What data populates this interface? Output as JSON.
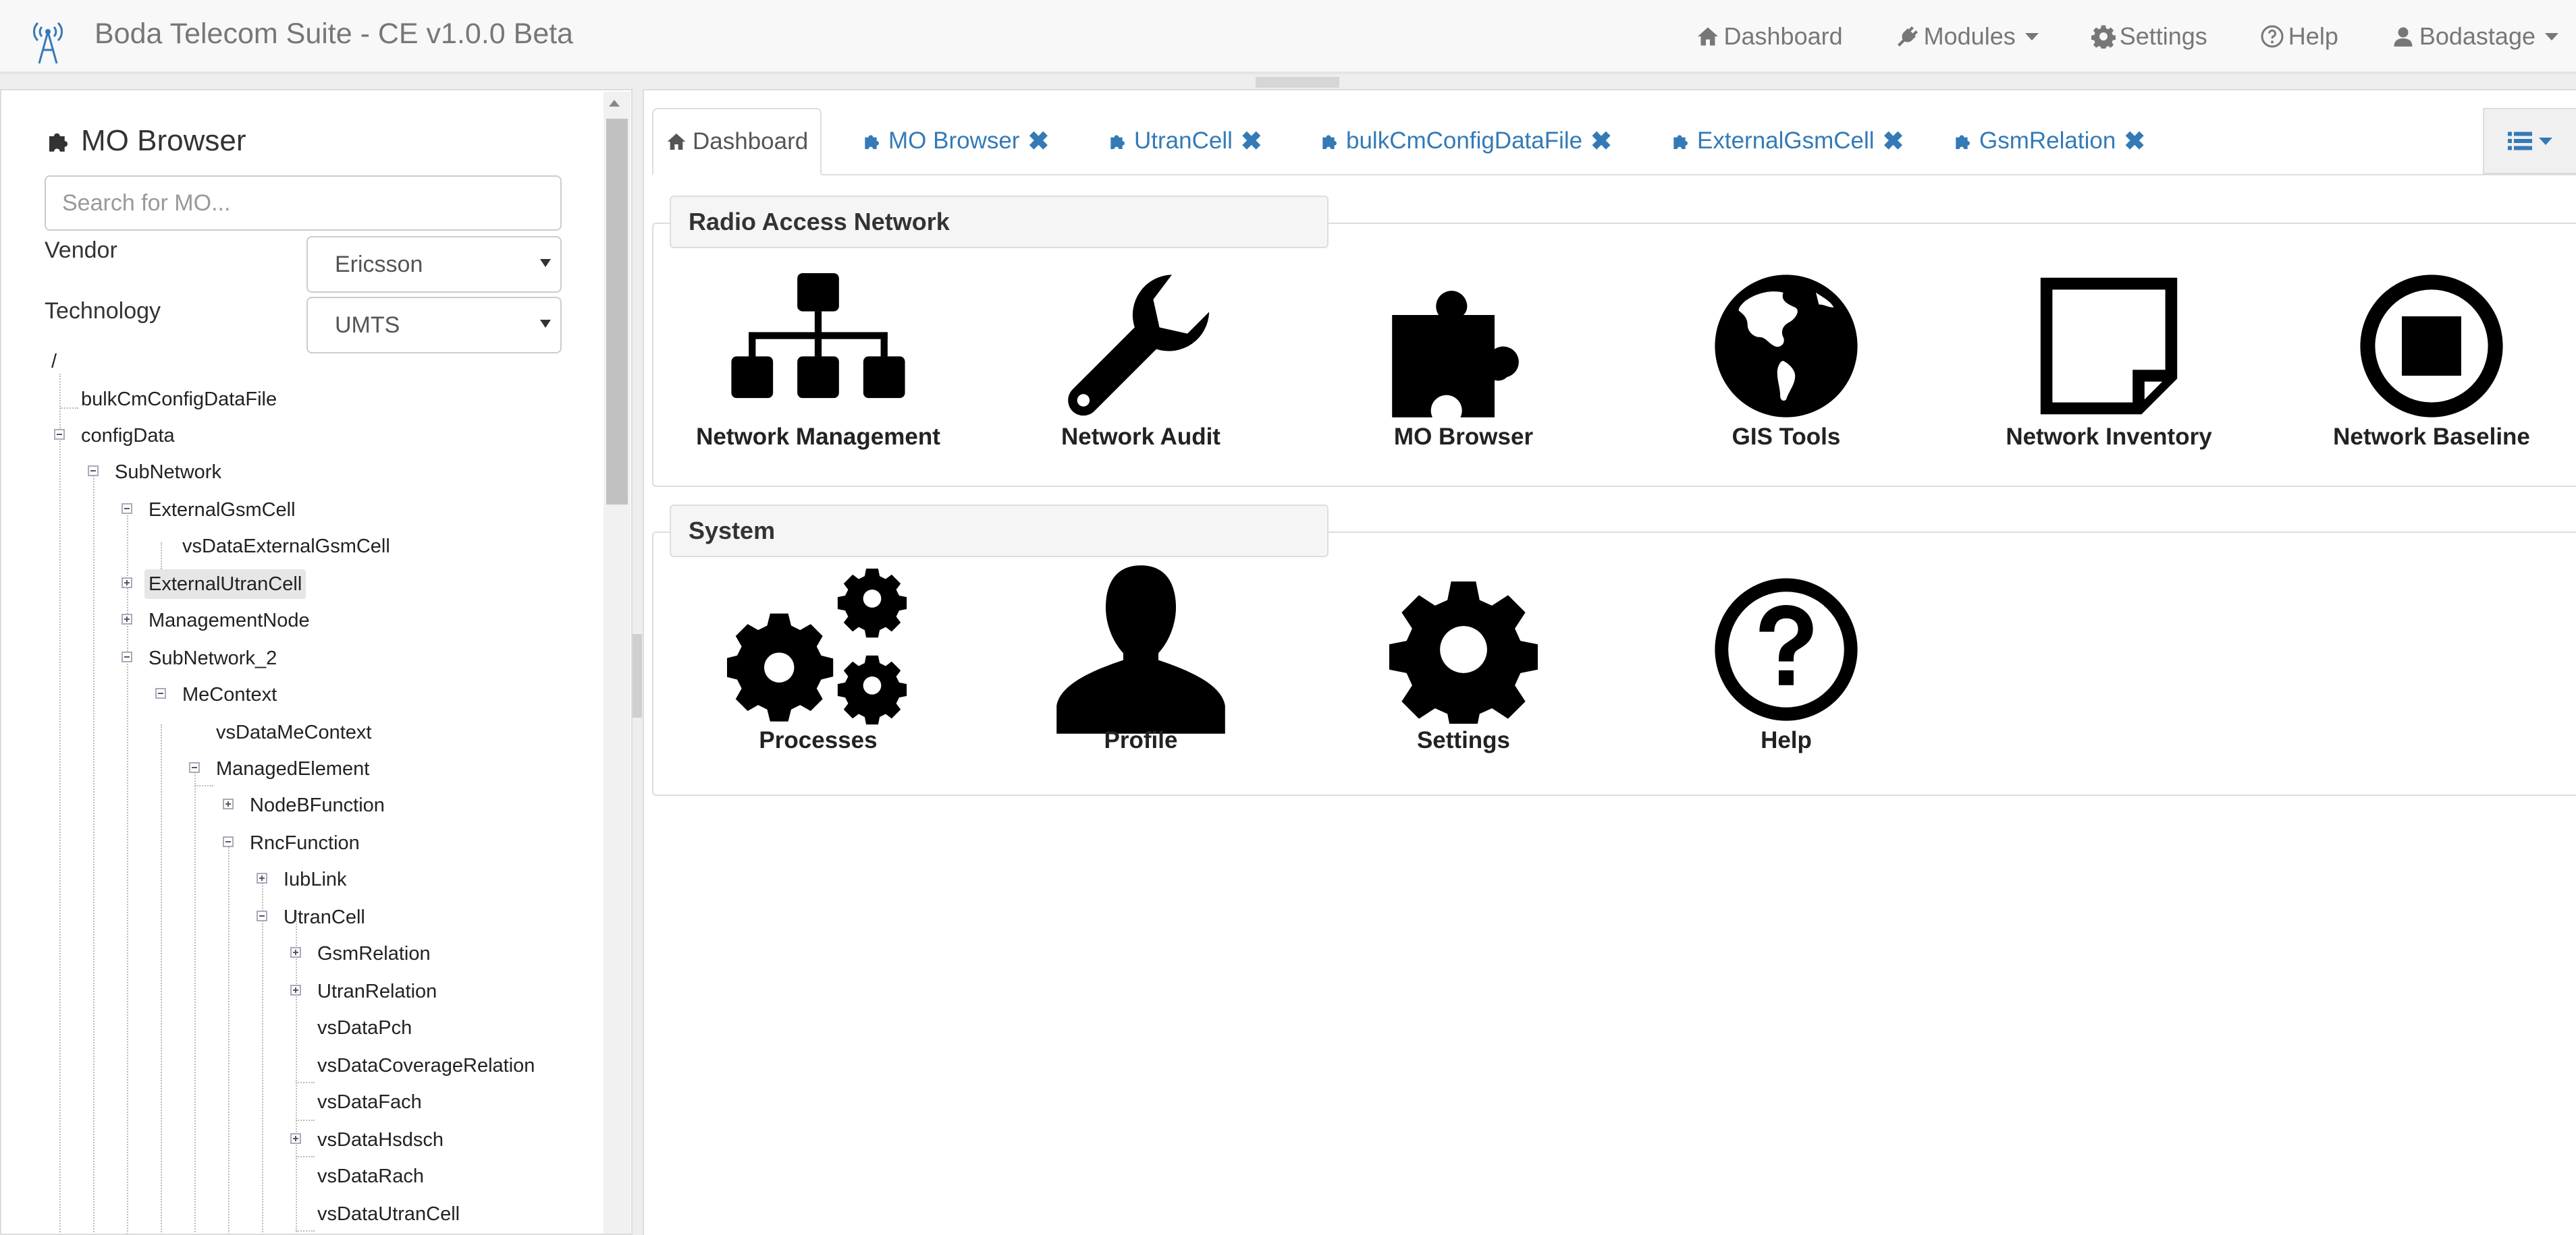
{
  "navbar": {
    "brand": "Boda Telecom Suite - CE v1.0.0 Beta",
    "items": [
      {
        "label": "Dashboard",
        "icon": "home-icon"
      },
      {
        "label": "Modules",
        "icon": "plug-icon"
      },
      {
        "label": "Settings",
        "icon": "gear-icon"
      },
      {
        "label": "Help",
        "icon": "question-circle-icon"
      },
      {
        "label": "Bodastage",
        "icon": "user-icon"
      }
    ]
  },
  "sidebar": {
    "title": "MO Browser",
    "search_placeholder": "Search for MO...",
    "vendor_label": "Vendor",
    "vendor_value": "Ericsson",
    "technology_label": "Technology",
    "technology_value": "UMTS",
    "tree": [
      {
        "label": "/"
      },
      {
        "label": "bulkCmConfigDataFile"
      },
      {
        "label": "configData",
        "toggle": "minus"
      },
      {
        "label": "SubNetwork",
        "toggle": "minus"
      },
      {
        "label": "ExternalGsmCell",
        "toggle": "minus"
      },
      {
        "label": "vsDataExternalGsmCell"
      },
      {
        "label": "ExternalUtranCell",
        "toggle": "plus",
        "selected": true
      },
      {
        "label": "ManagementNode",
        "toggle": "plus"
      },
      {
        "label": "SubNetwork_2",
        "toggle": "minus"
      },
      {
        "label": "MeContext",
        "toggle": "minus"
      },
      {
        "label": "vsDataMeContext"
      },
      {
        "label": "ManagedElement",
        "toggle": "minus"
      },
      {
        "label": "NodeBFunction",
        "toggle": "plus"
      },
      {
        "label": "RncFunction",
        "toggle": "minus"
      },
      {
        "label": "IubLink",
        "toggle": "plus"
      },
      {
        "label": "UtranCell",
        "toggle": "minus"
      },
      {
        "label": "GsmRelation",
        "toggle": "plus"
      },
      {
        "label": "UtranRelation",
        "toggle": "plus"
      },
      {
        "label": "vsDataPch"
      },
      {
        "label": "vsDataCoverageRelation"
      },
      {
        "label": "vsDataFach"
      },
      {
        "label": "vsDataHsdsch",
        "toggle": "plus"
      },
      {
        "label": "vsDataRach"
      },
      {
        "label": "vsDataUtranCell"
      }
    ]
  },
  "tabs": [
    {
      "label": "Dashboard",
      "icon": "home-icon",
      "closable": false,
      "active": true
    },
    {
      "label": "MO Browser",
      "icon": "puzzle-icon",
      "closable": true
    },
    {
      "label": "UtranCell",
      "icon": "puzzle-icon",
      "closable": true
    },
    {
      "label": "bulkCmConfigDataFile",
      "icon": "puzzle-icon",
      "closable": true
    },
    {
      "label": "ExternalGsmCell",
      "icon": "puzzle-icon",
      "closable": true
    },
    {
      "label": "GsmRelation",
      "icon": "puzzle-icon",
      "closable": true
    }
  ],
  "tab_close_glyph": "✖",
  "dashboard": {
    "radio_access_network": {
      "title": "Radio Access Network",
      "tiles": [
        {
          "label": "Network Management",
          "icon": "sitemap-icon"
        },
        {
          "label": "Network Audit",
          "icon": "wrench-icon"
        },
        {
          "label": "MO Browser",
          "icon": "puzzle-icon"
        },
        {
          "label": "GIS Tools",
          "icon": "globe-icon"
        },
        {
          "label": "Network Inventory",
          "icon": "sticky-note-icon"
        },
        {
          "label": "Network Baseline",
          "icon": "stop-circle-icon"
        }
      ]
    },
    "system": {
      "title": "System",
      "tiles": [
        {
          "label": "Processes",
          "icon": "cogs-icon"
        },
        {
          "label": "Profile",
          "icon": "user-silhouette-icon"
        },
        {
          "label": "Settings",
          "icon": "gear-icon"
        },
        {
          "label": "Help",
          "icon": "question-circle-icon"
        }
      ]
    }
  },
  "colors": {
    "link": "#337ab7",
    "navbar_bg": "#f8f8f8",
    "selected_node_bg": "#e6e6e6"
  }
}
